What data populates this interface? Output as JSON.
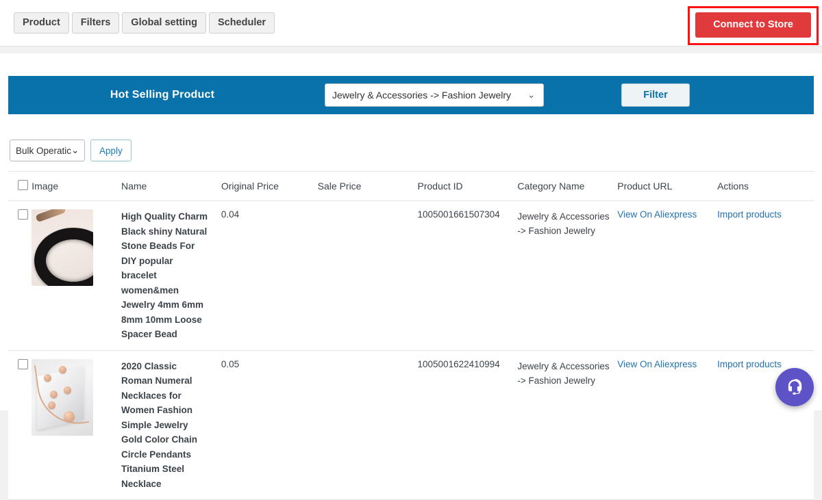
{
  "tabs": [
    {
      "label": "Product"
    },
    {
      "label": "Filters"
    },
    {
      "label": "Global setting"
    },
    {
      "label": "Scheduler"
    }
  ],
  "header": {
    "connect_button": "Connect to Store",
    "connect_button_color": "#e03a3c",
    "highlight_color": "#ff1111"
  },
  "banner": {
    "title": "Hot Selling Product",
    "background_color": "#0a72ab",
    "category_select": {
      "value": "Jewelry & Accessories -> Fashion Jewelry",
      "chevron": "⌄"
    },
    "filter_button": "Filter"
  },
  "bulk": {
    "select_value": "Bulk Operatic",
    "chevron": "⌄",
    "apply_button": "Apply"
  },
  "table": {
    "columns": [
      "Image",
      "Name",
      "Original Price",
      "Sale Price",
      "Product ID",
      "Category Name",
      "Product URL",
      "Actions"
    ],
    "rows": [
      {
        "name": "High Quality Charm Black shiny Natural Stone Beads For DIY popular bracelet women&men Jewelry 4mm 6mm 8mm 10mm Loose Spacer Bead",
        "original_price": "0.04",
        "sale_price": "",
        "product_id": "1005001661507304",
        "category_line1": "Jewelry & Accessories",
        "category_line2": "-> Fashion Jewelry",
        "product_url_label": "View On Aliexpress",
        "action_label": "Import products"
      },
      {
        "name": "2020 Classic Roman Numeral Necklaces for Women Fashion Simple Jewelry Gold Color Chain Circle Pendants Titanium Steel Necklace",
        "original_price": "0.05",
        "sale_price": "",
        "product_id": "1005001622410994",
        "category_line1": "Jewelry & Accessories",
        "category_line2": "-> Fashion Jewelry",
        "product_url_label": "View On Aliexpress",
        "action_label": "Import products"
      }
    ]
  },
  "support": {
    "icon": "headset-icon",
    "color": "#5d53c6"
  }
}
